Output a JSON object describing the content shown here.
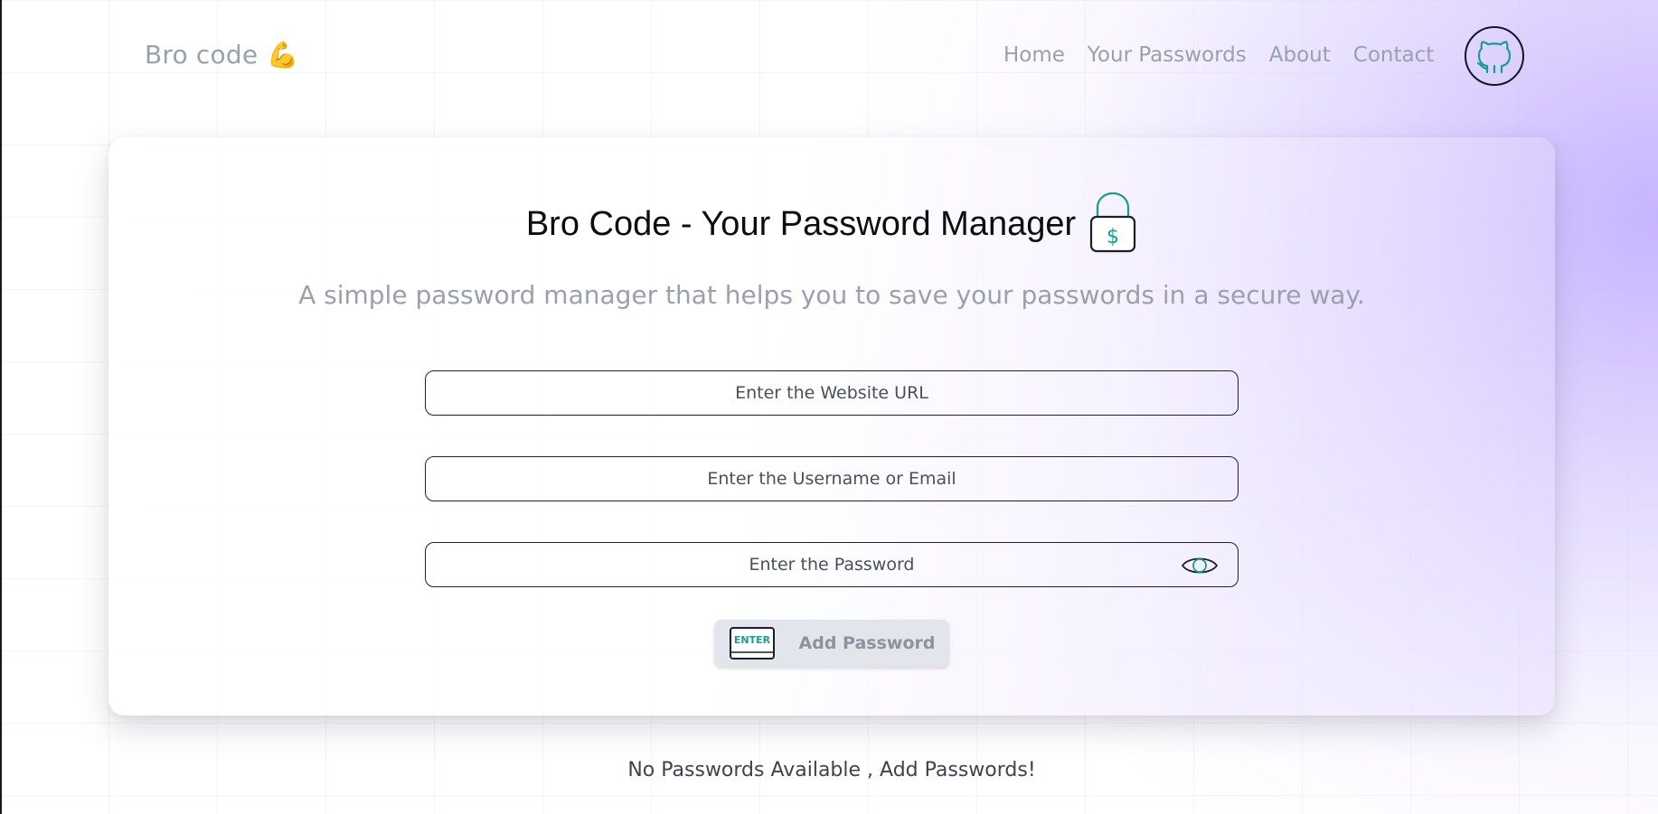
{
  "nav": {
    "logo_text": "Bro code",
    "logo_emoji": "💪",
    "links": [
      "Home",
      "Your Passwords",
      "About",
      "Contact"
    ],
    "github_icon": "github-icon"
  },
  "hero": {
    "title": "Bro Code - Your Password Manager",
    "title_icon": "lock-dollar-icon",
    "subtitle": "A simple password manager that helps you to save your passwords in a secure way."
  },
  "form": {
    "url_placeholder": "Enter the Website URL",
    "url_value": "",
    "username_placeholder": "Enter the Username or Email",
    "username_value": "",
    "password_placeholder": "Enter the Password",
    "password_value": "",
    "show_password_icon": "eye-icon",
    "submit_icon": "enter-key-icon",
    "submit_label": "Add Password"
  },
  "passwords": {
    "empty_message": "No Passwords Available , Add Passwords!"
  },
  "colors": {
    "accent": "#14a08c",
    "muted_text": "#9aa0ac",
    "tint": "#c4b0ff"
  }
}
